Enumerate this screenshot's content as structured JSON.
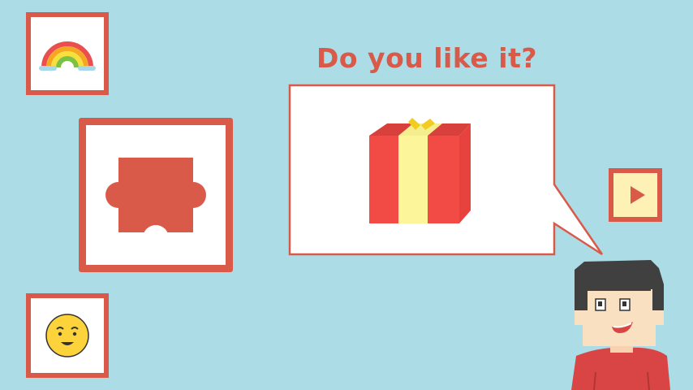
{
  "question": "Do you like it?",
  "options": [
    {
      "id": "rainbow",
      "icon": "rainbow-icon"
    },
    {
      "id": "puzzle-piece",
      "icon": "puzzle-piece-icon"
    },
    {
      "id": "smiley",
      "icon": "smiley-face-icon"
    }
  ],
  "speech_bubble": {
    "content_icon": "gift-box-icon"
  },
  "play_button": {
    "icon": "play-icon"
  },
  "character": {
    "icon": "boy-character"
  },
  "colors": {
    "background": "#acdce6",
    "accent": "#d95a49",
    "gift_red": "#f24b46",
    "gift_ribbon": "#fdf59a",
    "play_fill": "#fdf1b5"
  }
}
